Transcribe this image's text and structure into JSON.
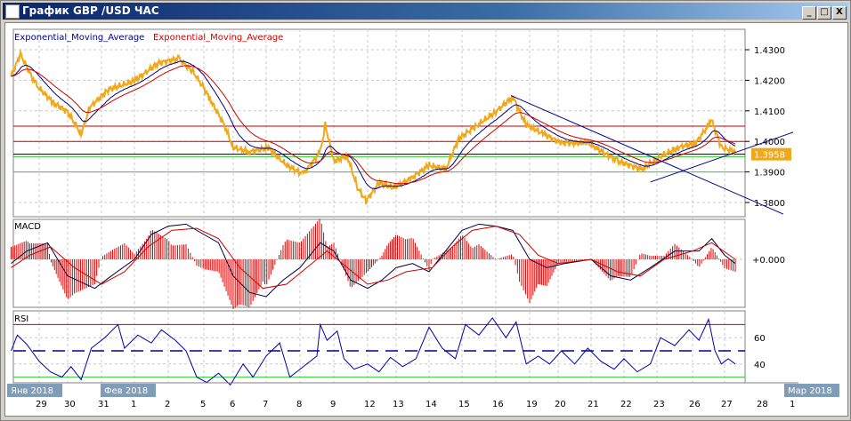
{
  "window": {
    "title": "График GBP /USD  ЧАС",
    "minimize": "_",
    "maximize": "□",
    "close": "X"
  },
  "legend": {
    "ema1": "Exponential_Moving_Average",
    "ema2": "Exponential_Moving_Average"
  },
  "panels": {
    "macd": "MACD",
    "rsi": "RSI"
  },
  "colors": {
    "price": "#f0a818",
    "ema_fast": "#00008b",
    "ema_slow": "#cc0000",
    "resistance": "#cc0000",
    "support": "#33cc33",
    "trend": "#00008b"
  },
  "chart_data": {
    "type": "line",
    "title": "GBP/USD H1",
    "price_axis": {
      "ticks": [
        "1.4300",
        "1.4200",
        "1.4100",
        "1.4000",
        "1.3900",
        "1.3800"
      ],
      "range": [
        1.3745,
        1.437
      ]
    },
    "current_price": "1.3958",
    "dates": [
      "29",
      "30",
      "31",
      "1",
      "2",
      "5",
      "6",
      "7",
      "8",
      "9",
      "12",
      "13",
      "14",
      "15",
      "16",
      "19",
      "20",
      "21",
      "22",
      "23",
      "26",
      "27",
      "28",
      "1"
    ],
    "month_labels": [
      {
        "label": "Янв 2018",
        "at": 0
      },
      {
        "label": "Фев 2018",
        "at": 3
      },
      {
        "label": "Мар 2018",
        "at": 23
      }
    ],
    "price": [
      [
        -0.9,
        1.4213
      ],
      [
        -0.6,
        1.4285
      ],
      [
        -0.1,
        1.4184
      ],
      [
        0.5,
        1.4126
      ],
      [
        1,
        1.4097
      ],
      [
        1.4,
        1.4024
      ],
      [
        1.65,
        1.4111
      ],
      [
        2.2,
        1.4169
      ],
      [
        3,
        1.4198
      ],
      [
        3.7,
        1.4256
      ],
      [
        4.3,
        1.4271
      ],
      [
        4.7,
        1.4227
      ],
      [
        5.2,
        1.414
      ],
      [
        5.7,
        1.4053
      ],
      [
        6,
        1.398
      ],
      [
        6.5,
        1.3966
      ],
      [
        7.05,
        1.398
      ],
      [
        7.6,
        1.3922
      ],
      [
        8.1,
        1.3893
      ],
      [
        8.6,
        1.3966
      ],
      [
        8.75,
        1.4053
      ],
      [
        9,
        1.3936
      ],
      [
        9.4,
        1.3951
      ],
      [
        9.7,
        1.3849
      ],
      [
        9.95,
        1.3806
      ],
      [
        10.4,
        1.3864
      ],
      [
        10.9,
        1.3849
      ],
      [
        11.45,
        1.3878
      ],
      [
        12,
        1.3922
      ],
      [
        12.5,
        1.3908
      ],
      [
        12.9,
        1.4009
      ],
      [
        13.45,
        1.4053
      ],
      [
        14,
        1.4097
      ],
      [
        14.5,
        1.4146
      ],
      [
        14.9,
        1.4053
      ],
      [
        15.5,
        1.4024
      ],
      [
        16.1,
        1.3995
      ],
      [
        16.9,
        1.3995
      ],
      [
        17.8,
        1.3936
      ],
      [
        18.55,
        1.3908
      ],
      [
        19.1,
        1.3951
      ],
      [
        19.6,
        1.398
      ],
      [
        20.1,
        1.3995
      ],
      [
        20.5,
        1.4053
      ],
      [
        20.6,
        1.4068
      ],
      [
        20.9,
        1.398
      ],
      [
        21.3,
        1.3966
      ]
    ],
    "hlines": {
      "resistance": [
        1.405,
        1.4
      ],
      "support": [
        1.395,
        1.39
      ],
      "current": 1.3958
    },
    "trendlines": [
      [
        [
          14.45,
          1.415
        ],
        [
          22.7,
          1.3762
        ]
      ],
      [
        [
          18.8,
          1.3867
        ],
        [
          23.6,
          1.403
        ]
      ]
    ],
    "macd": {
      "zero_label": "+0.000",
      "range": [
        -0.009,
        0.009
      ],
      "main": [
        [
          -0.9,
          -0.001
        ],
        [
          -0.4,
          0.002
        ],
        [
          0.3,
          0.004
        ],
        [
          1,
          -0.004
        ],
        [
          1.8,
          -0.007
        ],
        [
          2.3,
          -0.004
        ],
        [
          3,
          0.0
        ],
        [
          3.5,
          0.006
        ],
        [
          4,
          0.008
        ],
        [
          4.5,
          0.0085
        ],
        [
          5,
          0.006
        ],
        [
          5.5,
          0.004
        ],
        [
          6,
          -0.004
        ],
        [
          6.5,
          -0.008
        ],
        [
          7,
          -0.009
        ],
        [
          7.5,
          -0.005
        ],
        [
          8,
          -0.002
        ],
        [
          8.6,
          0.004
        ],
        [
          9,
          0.002
        ],
        [
          9.5,
          -0.005
        ],
        [
          10,
          -0.007
        ],
        [
          10.5,
          -0.005
        ],
        [
          11,
          -0.002
        ],
        [
          11.5,
          -0.001
        ],
        [
          12,
          -0.003
        ],
        [
          12.5,
          0.002
        ],
        [
          13,
          0.007
        ],
        [
          13.5,
          0.0085
        ],
        [
          14,
          0.008
        ],
        [
          14.5,
          0.007
        ],
        [
          15,
          0.0
        ],
        [
          15.6,
          -0.002
        ],
        [
          16.2,
          -0.001
        ],
        [
          17,
          0.0
        ],
        [
          17.6,
          -0.004
        ],
        [
          18.2,
          -0.005
        ],
        [
          18.8,
          -0.002
        ],
        [
          19.5,
          0.002
        ],
        [
          20.2,
          0.002
        ],
        [
          20.6,
          0.005
        ],
        [
          21,
          0.001
        ],
        [
          21.3,
          -0.001
        ]
      ],
      "signal": [
        [
          -0.9,
          -0.002
        ],
        [
          -0.3,
          0.001
        ],
        [
          0.4,
          0.003
        ],
        [
          1.2,
          -0.002
        ],
        [
          2,
          -0.006
        ],
        [
          2.7,
          -0.003
        ],
        [
          3.4,
          0.003
        ],
        [
          4.1,
          0.007
        ],
        [
          4.8,
          0.0075
        ],
        [
          5.5,
          0.005
        ],
        [
          6.2,
          -0.002
        ],
        [
          6.9,
          -0.007
        ],
        [
          7.6,
          -0.006
        ],
        [
          8.2,
          -0.002
        ],
        [
          8.8,
          0.002
        ],
        [
          9.4,
          -0.002
        ],
        [
          10,
          -0.006
        ],
        [
          10.7,
          -0.005
        ],
        [
          11.3,
          -0.003
        ],
        [
          12.1,
          -0.002
        ],
        [
          12.7,
          0.003
        ],
        [
          13.3,
          0.007
        ],
        [
          14,
          0.008
        ],
        [
          14.7,
          0.006
        ],
        [
          15.3,
          0.001
        ],
        [
          16,
          -0.001
        ],
        [
          17,
          0.0
        ],
        [
          17.8,
          -0.003
        ],
        [
          18.5,
          -0.004
        ],
        [
          19.2,
          0.0
        ],
        [
          20,
          0.002
        ],
        [
          20.6,
          0.004
        ],
        [
          21.3,
          0.0
        ]
      ]
    },
    "rsi": {
      "ticks": [
        "60",
        "40"
      ],
      "levels": [
        70,
        50,
        30
      ],
      "values": [
        [
          -0.9,
          50
        ],
        [
          -0.7,
          62
        ],
        [
          -0.4,
          55
        ],
        [
          0,
          42
        ],
        [
          0.4,
          34
        ],
        [
          0.8,
          30
        ],
        [
          1.1,
          38
        ],
        [
          1.4,
          28
        ],
        [
          1.7,
          52
        ],
        [
          2.1,
          60
        ],
        [
          2.5,
          70
        ],
        [
          2.7,
          52
        ],
        [
          3.1,
          62
        ],
        [
          3.5,
          56
        ],
        [
          3.8,
          66
        ],
        [
          4.2,
          58
        ],
        [
          4.5,
          50
        ],
        [
          4.8,
          30
        ],
        [
          5.1,
          26
        ],
        [
          5.5,
          33
        ],
        [
          5.9,
          24
        ],
        [
          6.3,
          40
        ],
        [
          6.6,
          30
        ],
        [
          7,
          46
        ],
        [
          7.4,
          56
        ],
        [
          7.7,
          30
        ],
        [
          8.1,
          38
        ],
        [
          8.5,
          46
        ],
        [
          8.6,
          70
        ],
        [
          8.8,
          58
        ],
        [
          9.1,
          65
        ],
        [
          9.3,
          44
        ],
        [
          9.6,
          36
        ],
        [
          10,
          40
        ],
        [
          10.4,
          34
        ],
        [
          10.8,
          45
        ],
        [
          11.2,
          38
        ],
        [
          11.6,
          44
        ],
        [
          12,
          68
        ],
        [
          12.4,
          52
        ],
        [
          12.8,
          44
        ],
        [
          13.1,
          70
        ],
        [
          13.5,
          62
        ],
        [
          13.9,
          75
        ],
        [
          14.3,
          60
        ],
        [
          14.6,
          72
        ],
        [
          14.9,
          40
        ],
        [
          15.3,
          46
        ],
        [
          15.7,
          40
        ],
        [
          16.1,
          50
        ],
        [
          16.5,
          40
        ],
        [
          16.9,
          52
        ],
        [
          17.3,
          42
        ],
        [
          17.7,
          36
        ],
        [
          18,
          44
        ],
        [
          18.4,
          34
        ],
        [
          18.8,
          40
        ],
        [
          19.1,
          60
        ],
        [
          19.5,
          54
        ],
        [
          19.9,
          66
        ],
        [
          20.2,
          58
        ],
        [
          20.5,
          74
        ],
        [
          20.7,
          50
        ],
        [
          20.9,
          40
        ],
        [
          21.1,
          44
        ],
        [
          21.3,
          40
        ]
      ]
    }
  }
}
